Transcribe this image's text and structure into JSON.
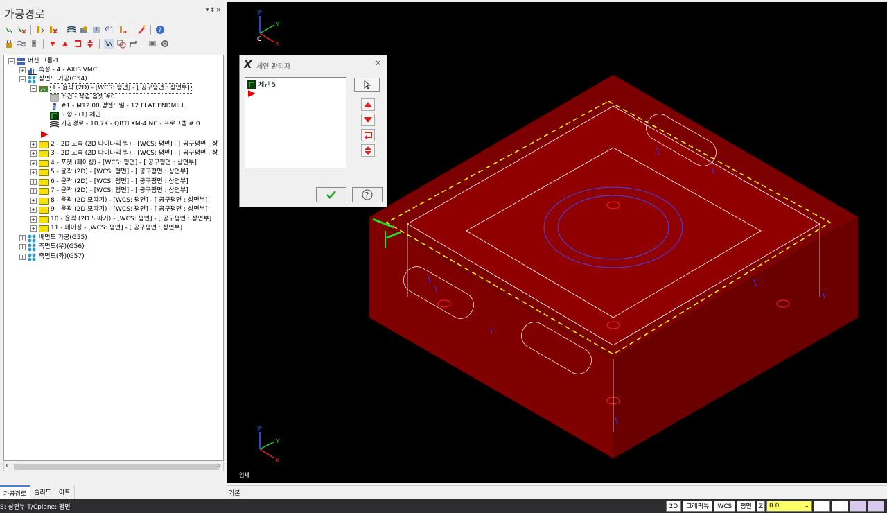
{
  "panel": {
    "title": "가공경로",
    "pin_label": "▾ ‡ ×"
  },
  "tree": {
    "machine_group": "머신 그룹-1",
    "properties": "속성 - 4 - AXIS VMC",
    "top_machining": "상면도 가공(G54)",
    "op1": "1 - 윤곽 (2D) - [WCS: 평면] - [ 공구평면 : 상면부]",
    "op1_params": "조건 - 작업 옵셋 #0",
    "op1_tool": "#1 - M12.00 평엔드밀 - 12 FLAT ENDMILL",
    "op1_geometry": "도형 - (1) 체인",
    "op1_toolpath": "가공경로 - 10.7K - QBTLXM-4.NC - 프로그램 # 0",
    "ops": [
      "2 - 2D 고속 (2D 다이나믹 밀) - [WCS: 평면] - [ 공구평면 : 상",
      "3 - 2D 고속 (2D 다이나믹 밀) - [WCS: 평면] - [ 공구평면 : 상",
      "4 - 포켓 (페이싱) - [WCS: 평면] - [ 공구평면 : 상면부]",
      "5 - 윤곽 (2D) - [WCS: 평면] - [ 공구평면 : 상면부]",
      "6 - 윤곽 (2D) - [WCS: 평면] - [ 공구평면 : 상면부]",
      "7 - 윤곽 (2D) - [WCS: 평면] - [ 공구평면 : 상면부]",
      "8 - 윤곽 (2D 모따기) - [WCS: 평면] - [ 공구평면 : 상면부]",
      "9 - 윤곽 (2D 모따기) - [WCS: 평면] - [ 공구평면 : 상면부]",
      "10 - 윤곽 (2D 모따기) - [WCS: 평면] - [ 공구평면 : 상면부]",
      "11 - 페이싱 - [WCS: 평면] - [ 공구평면 : 상면부]"
    ],
    "back_machining": "배면도 가공(G55)",
    "right_side": "측면도(우)(G56)",
    "left_side": "측면도(좌)(G57)"
  },
  "tabs": [
    "가공경로",
    "솔리드",
    "아트"
  ],
  "dialog": {
    "title": "체인 관리자",
    "item": "체인 5",
    "logo": "X"
  },
  "viewport": {
    "label": "입체",
    "tab": "기본",
    "axis_x": "X",
    "axis_y": "Y",
    "axis_z": "Z",
    "axis_c": "C"
  },
  "status": {
    "left": "S: 상면부  T/Cplane: 평면",
    "btn_2d": "2D",
    "btn_graphic": "그래픽뷰",
    "btn_wcs": "WCS",
    "btn_plane": "평면",
    "z_label": "Z",
    "z_value": "0.0"
  },
  "colors": {
    "viewport_bg": "#000000",
    "part": "#8b0000",
    "chain_dash": "#ffff00"
  }
}
